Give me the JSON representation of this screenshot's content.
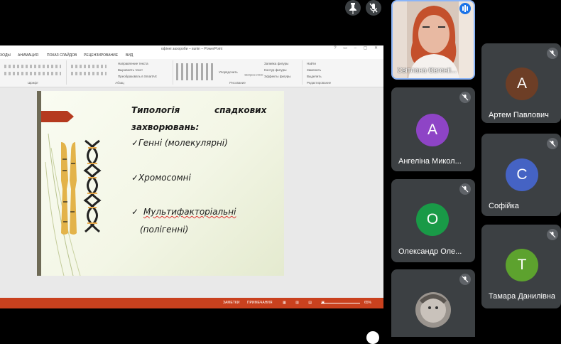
{
  "top_controls": {
    "pin_icon": "pin-icon",
    "mute_icon": "mic-off-icon"
  },
  "presentation": {
    "window_title": "офінні захороби – sunin – PowerPoint",
    "ribbon_tabs": [
      "ХОДЫ",
      "АНИМАЦИЯ",
      "ПОКАЗ СЛАЙДОВ",
      "РЕЦЕНЗИРОВАНИЕ",
      "ВИД"
    ],
    "ribbon_groups": [
      "Шрифт",
      "Абзац",
      "Рисование",
      "Редактирование"
    ],
    "ribbon_items": {
      "text_direction": "Направление текста",
      "align_text": "Выровнять текст",
      "smartart": "Преобразовать в SmartArt",
      "arrange": "Упорядочить",
      "quick_styles": "Экспресс-стили",
      "shape_fill": "Заливка фигуры",
      "shape_outline": "Контур фигуры",
      "shape_effects": "Эффекты фигуры",
      "find": "Найти",
      "replace": "Заменить",
      "select": "Выделить"
    },
    "slide": {
      "title_line1": "Типологія",
      "title_line1b": "спадкових",
      "title_line2": "захворювань:",
      "item1": "✓Генні  (молекулярні)",
      "item2": "✓Хромосомні",
      "item3_check": "✓",
      "item3": "Мультифакторіальні",
      "item3_sub": "(полігенні)"
    },
    "status": {
      "notes": "ЗАМЕТКИ",
      "comments": "ПРИМЕЧАНИЯ",
      "zoom": "65%"
    }
  },
  "participants": [
    {
      "name": "Світлана Євгеніі...",
      "type": "video",
      "speaking": true
    },
    {
      "name": "Артем  Павлович",
      "initial": "A",
      "color": "#6d3e26",
      "muted": true
    },
    {
      "name": "Ангеліна  Микол...",
      "initial": "A",
      "color": "#8e44c6",
      "muted": true
    },
    {
      "name": "Софійка",
      "initial": "C",
      "color": "#4563c4",
      "muted": true
    },
    {
      "name": "Олександр  Оле...",
      "initial": "O",
      "color": "#199a47",
      "muted": true
    },
    {
      "name": "Тамара Данилівна",
      "initial": "T",
      "color": "#5da22e",
      "muted": true
    },
    {
      "name": "",
      "type": "photo",
      "muted": true
    }
  ]
}
